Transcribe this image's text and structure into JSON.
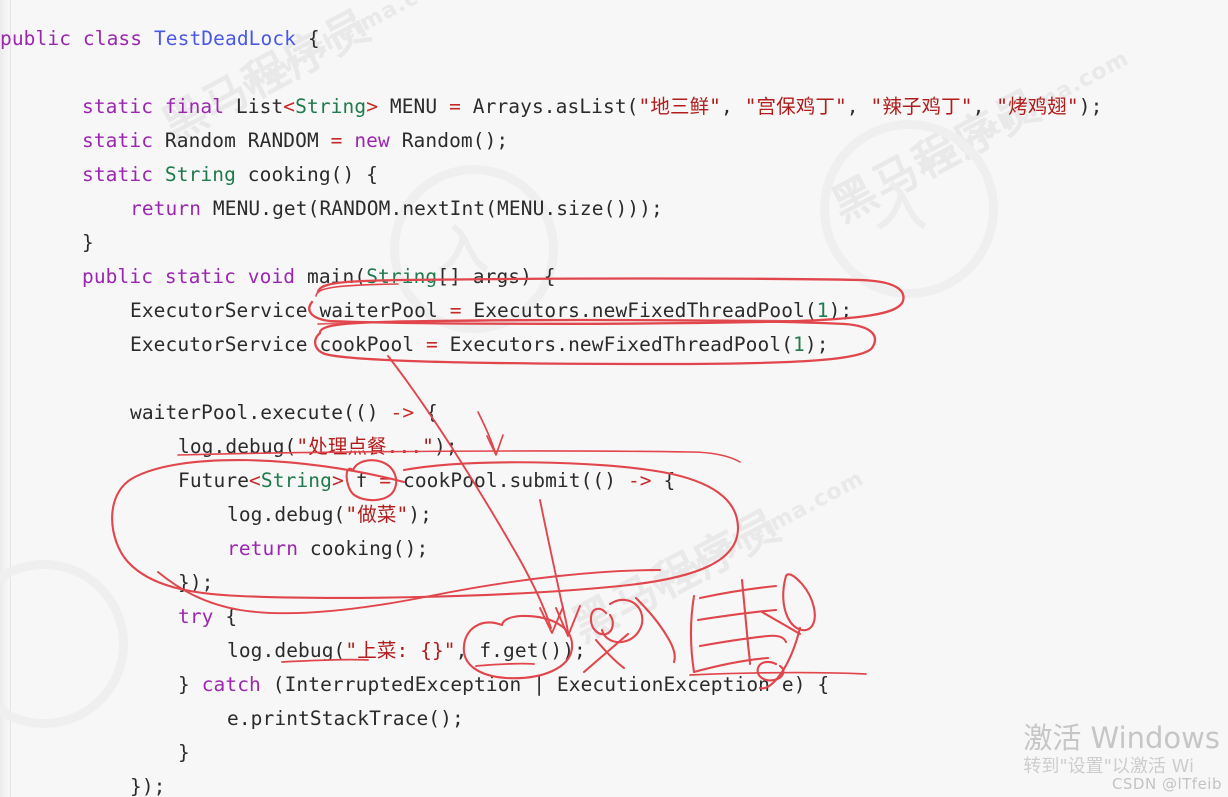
{
  "window": {
    "background_color": "#f7f7f7",
    "annotation_color": "#e0464c"
  },
  "editor": {
    "language": "java",
    "class_name": "TestDeadLock",
    "theme_colors": {
      "keyword": "#9b27b0",
      "class_name": "#4a58e8",
      "generic_type": "#1f7a4d",
      "operator": "#c62828",
      "string": "#b11c1c",
      "number": "#1f7a4d",
      "plain": "#2b2b2b"
    },
    "code_lines": [
      {
        "indent": 0,
        "tokens": [
          {
            "t": "public",
            "c": "kw"
          },
          {
            "t": " ",
            "c": "pl"
          },
          {
            "t": "class",
            "c": "kw"
          },
          {
            "t": " ",
            "c": "pl"
          },
          {
            "t": "TestDeadLock",
            "c": "type"
          },
          {
            "t": " {",
            "c": "pl"
          }
        ]
      },
      {
        "indent": 0,
        "tokens": []
      },
      {
        "indent": 2,
        "tokens": [
          {
            "t": "static",
            "c": "kw"
          },
          {
            "t": " ",
            "c": "pl"
          },
          {
            "t": "final",
            "c": "kw"
          },
          {
            "t": " List",
            "c": "pl"
          },
          {
            "t": "<",
            "c": "op"
          },
          {
            "t": "String",
            "c": "gen"
          },
          {
            "t": ">",
            "c": "op"
          },
          {
            "t": " MENU ",
            "c": "pl"
          },
          {
            "t": "=",
            "c": "op"
          },
          {
            "t": " Arrays.asList(",
            "c": "pl"
          },
          {
            "t": "\"地三鲜\"",
            "c": "str"
          },
          {
            "t": ", ",
            "c": "pl"
          },
          {
            "t": "\"宫保鸡丁\"",
            "c": "str"
          },
          {
            "t": ", ",
            "c": "pl"
          },
          {
            "t": "\"辣子鸡丁\"",
            "c": "str"
          },
          {
            "t": ", ",
            "c": "pl"
          },
          {
            "t": "\"烤鸡翅\"",
            "c": "str"
          },
          {
            "t": ");",
            "c": "pl"
          }
        ]
      },
      {
        "indent": 2,
        "tokens": [
          {
            "t": "static",
            "c": "kw"
          },
          {
            "t": " Random RANDOM ",
            "c": "pl"
          },
          {
            "t": "=",
            "c": "op"
          },
          {
            "t": " ",
            "c": "pl"
          },
          {
            "t": "new",
            "c": "kw"
          },
          {
            "t": " Random();",
            "c": "pl"
          }
        ]
      },
      {
        "indent": 2,
        "tokens": [
          {
            "t": "static",
            "c": "kw"
          },
          {
            "t": " ",
            "c": "pl"
          },
          {
            "t": "String",
            "c": "gen"
          },
          {
            "t": " cooking() {",
            "c": "pl"
          }
        ]
      },
      {
        "indent": 3,
        "tokens": [
          {
            "t": "return",
            "c": "kw"
          },
          {
            "t": " MENU.get(RANDOM.nextInt(MENU.size()));",
            "c": "pl"
          }
        ]
      },
      {
        "indent": 2,
        "tokens": [
          {
            "t": "}",
            "c": "pl"
          }
        ]
      },
      {
        "indent": 2,
        "tokens": [
          {
            "t": "public",
            "c": "kw"
          },
          {
            "t": " ",
            "c": "pl"
          },
          {
            "t": "static",
            "c": "kw"
          },
          {
            "t": " ",
            "c": "pl"
          },
          {
            "t": "void",
            "c": "kw"
          },
          {
            "t": " main(",
            "c": "pl"
          },
          {
            "t": "String",
            "c": "gen"
          },
          {
            "t": "[] args) {",
            "c": "pl"
          }
        ]
      },
      {
        "indent": 3,
        "tokens": [
          {
            "t": "ExecutorService waiterPool ",
            "c": "pl"
          },
          {
            "t": "=",
            "c": "op"
          },
          {
            "t": " Executors.newFixedThreadPool(",
            "c": "pl"
          },
          {
            "t": "1",
            "c": "num"
          },
          {
            "t": ");",
            "c": "pl"
          }
        ]
      },
      {
        "indent": 3,
        "tokens": [
          {
            "t": "ExecutorService cookPool ",
            "c": "pl"
          },
          {
            "t": "=",
            "c": "op"
          },
          {
            "t": " Executors.newFixedThreadPool(",
            "c": "pl"
          },
          {
            "t": "1",
            "c": "num"
          },
          {
            "t": ");",
            "c": "pl"
          }
        ]
      },
      {
        "indent": 0,
        "tokens": []
      },
      {
        "indent": 3,
        "tokens": [
          {
            "t": "waiterPool.execute(() ",
            "c": "pl"
          },
          {
            "t": "->",
            "c": "op"
          },
          {
            "t": " {",
            "c": "pl"
          }
        ]
      },
      {
        "indent": 4,
        "tokens": [
          {
            "t": "log.debug(",
            "c": "pl"
          },
          {
            "t": "\"处理点餐...\"",
            "c": "str"
          },
          {
            "t": ");",
            "c": "pl"
          }
        ]
      },
      {
        "indent": 4,
        "tokens": [
          {
            "t": "Future",
            "c": "pl"
          },
          {
            "t": "<",
            "c": "op"
          },
          {
            "t": "String",
            "c": "gen"
          },
          {
            "t": ">",
            "c": "op"
          },
          {
            "t": " f ",
            "c": "pl"
          },
          {
            "t": "=",
            "c": "op"
          },
          {
            "t": " cookPool.submit(() ",
            "c": "pl"
          },
          {
            "t": "->",
            "c": "op"
          },
          {
            "t": " {",
            "c": "pl"
          }
        ]
      },
      {
        "indent": 5,
        "tokens": [
          {
            "t": "log.debug(",
            "c": "pl"
          },
          {
            "t": "\"做菜\"",
            "c": "str"
          },
          {
            "t": ");",
            "c": "pl"
          }
        ]
      },
      {
        "indent": 5,
        "tokens": [
          {
            "t": "return",
            "c": "kw"
          },
          {
            "t": " cooking();",
            "c": "pl"
          }
        ]
      },
      {
        "indent": 4,
        "tokens": [
          {
            "t": "});",
            "c": "pl"
          }
        ]
      },
      {
        "indent": 4,
        "tokens": [
          {
            "t": "try",
            "c": "kw"
          },
          {
            "t": " {",
            "c": "pl"
          }
        ]
      },
      {
        "indent": 5,
        "tokens": [
          {
            "t": "log.debug(",
            "c": "pl"
          },
          {
            "t": "\"上菜: {}\"",
            "c": "str"
          },
          {
            "t": ", f.get());",
            "c": "pl"
          }
        ]
      },
      {
        "indent": 4,
        "tokens": [
          {
            "t": "} ",
            "c": "pl"
          },
          {
            "t": "catch",
            "c": "kw"
          },
          {
            "t": " (InterruptedException | ExecutionException e) {",
            "c": "pl"
          }
        ]
      },
      {
        "indent": 5,
        "tokens": [
          {
            "t": "e.printStackTrace();",
            "c": "pl"
          }
        ]
      },
      {
        "indent": 4,
        "tokens": [
          {
            "t": "}",
            "c": "pl"
          }
        ]
      },
      {
        "indent": 3,
        "tokens": [
          {
            "t": "});",
            "c": "pl"
          }
        ]
      }
    ]
  },
  "watermarks": {
    "brand_cn": "黑马程序员",
    "brand_url": "www.itheima.com",
    "brand_ring_glyph": "入"
  },
  "activation": {
    "title": "激活 Windows",
    "subtitle": "转到\"设置\"以激活 Wi"
  },
  "credit": {
    "text": "CSDN @lTfeib"
  },
  "annotations": {
    "description": "Hand-drawn red pen marks highlighting waiterPool, cookPool, the Future f variable and f.get() blocking call",
    "color": "#e0464c",
    "handwritten_note": "阻塞"
  }
}
